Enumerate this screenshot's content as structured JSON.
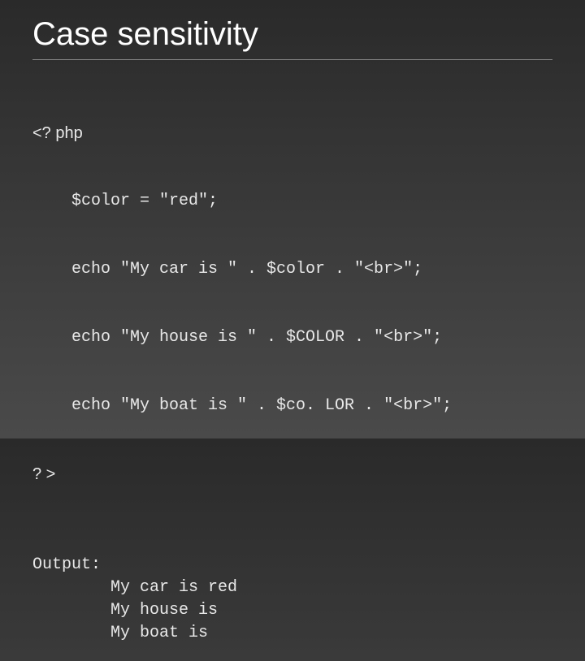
{
  "slide": {
    "title": "Case sensitivity",
    "code": {
      "open_tag": "<? php",
      "line1": "$color = \"red\";",
      "line2": "echo \"My car is \" . $color . \"<br>\";",
      "line3": "echo \"My house is \" . $COLOR . \"<br>\";",
      "line4": "echo \"My boat is \" . $co. LOR . \"<br>\";",
      "close_tag": "? >"
    },
    "output": {
      "label": "Output:",
      "line1": "My car is red",
      "line2": "My house is",
      "line3": "My boat is"
    }
  }
}
